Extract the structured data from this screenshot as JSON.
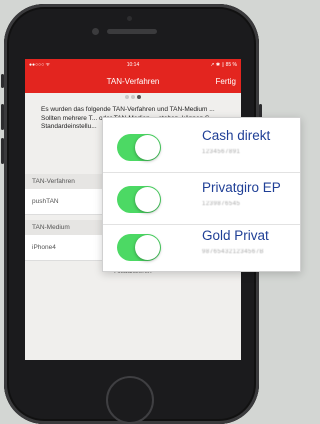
{
  "statusbar": {
    "carrier": "●●○○○ ᯤ",
    "time": "10:14",
    "right": "↗ ✱ ▯ 85 %"
  },
  "navbar": {
    "title": "TAN-Verfahren",
    "done_label": "Fertig"
  },
  "pager": {
    "count": 3,
    "active": 3
  },
  "info_text": "Es wurden das folgende TAN-Verfahren und TAN-Medium ... Sollten mehrere T... oder TAN-Medien ... stehen, können S... Standardeinstellu...",
  "tan_section": {
    "header": "TAN-Verfahren",
    "value": "pushTAN"
  },
  "medium_section": {
    "header": "TAN-Medium",
    "value": "iPhone4"
  },
  "refresh_label": "Aktualisieren",
  "accounts": [
    {
      "name": "Cash direkt",
      "number": "1234567891",
      "enabled": true
    },
    {
      "name": "Privatgiro EP",
      "number": "1239876545",
      "enabled": true
    },
    {
      "name": "Gold Privat",
      "number": "987654321234567B",
      "enabled": true
    }
  ],
  "colors": {
    "accent_red": "#e3251f",
    "toggle_on": "#4cd964",
    "account_name": "#1f3f96"
  }
}
